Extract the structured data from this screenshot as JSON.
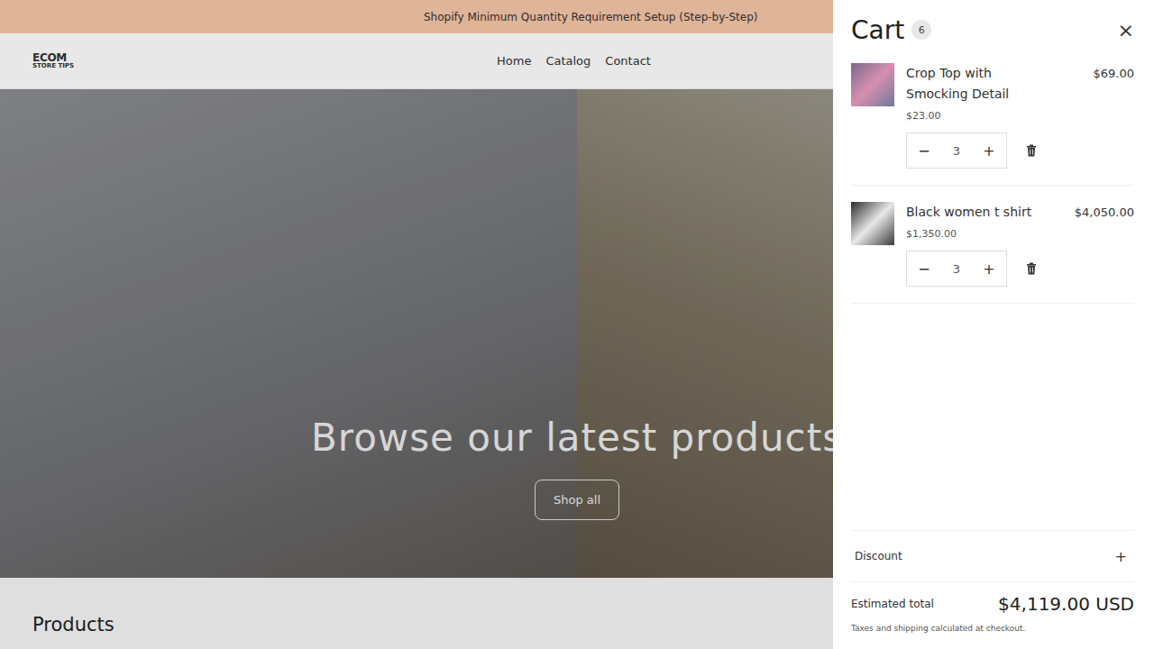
{
  "announcement": "Shopify Minimum Quantity Requirement Setup (Step-by-Step)",
  "logo": {
    "line1": "ECOM",
    "line2": "STORE TIPS"
  },
  "nav": [
    {
      "label": "Home"
    },
    {
      "label": "Catalog"
    },
    {
      "label": "Contact"
    }
  ],
  "hero": {
    "heading": "Browse our latest products",
    "button": "Shop all"
  },
  "section_title": "Products",
  "cart": {
    "title": "Cart",
    "count": "6",
    "close": "×",
    "items": [
      {
        "name": "Crop Top with Smocking Detail",
        "unit_price": "$23.00",
        "line_total": "$69.00",
        "quantity": "3",
        "minus": "−",
        "plus": "+"
      },
      {
        "name": "Black women t shirt",
        "unit_price": "$1,350.00",
        "line_total": "$4,050.00",
        "quantity": "3",
        "minus": "−",
        "plus": "+"
      }
    ],
    "discount": {
      "label": "Discount",
      "toggle": "+"
    },
    "total_label": "Estimated total",
    "total": "$4,119.00 USD",
    "note": "Taxes and shipping calculated at checkout."
  }
}
